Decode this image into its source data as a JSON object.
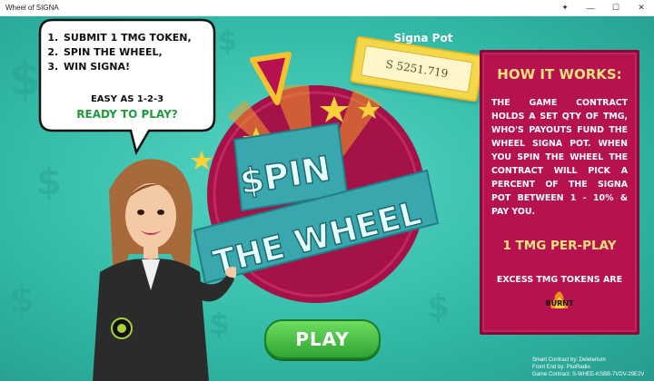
{
  "window": {
    "title": "Wheel of SIGNA",
    "controls": {
      "minimize": "—",
      "maximize": "☐",
      "close": "✕"
    }
  },
  "bubble": {
    "steps": [
      "SUBMIT 1 TMG TOKEN,",
      "SPIN THE WHEEL,",
      "WIN SIGNA!"
    ],
    "easy": "EASY AS 1-2-3",
    "ready": "READY TO PLAY?"
  },
  "wheel": {
    "line1": "$PIN",
    "line2": "THE WHEEL"
  },
  "pot": {
    "label": "Signa Pot",
    "value": "S 5251.719"
  },
  "how_it_works": {
    "title": "HOW IT WORKS:",
    "body": "THE GAME CONTRACT HOLDS A SET QTY OF TMG, WHO'S PAYOUTS FUND THE WHEEL SIGNA POT. WHEN YOU SPIN THE WHEEL THE CONTRACT WILL PICK A PERCENT OF THE SIGNA POT BETWEEN 1 - 10% & PAY YOU.",
    "per_play": "1 TMG PER-PLAY",
    "excess": "EXCESS TMG TOKENS ARE",
    "burnt": "BURNT"
  },
  "play_button": "PLAY",
  "credits": {
    "contract": "Smart Contract by: Deleterium",
    "frontend": "Front End by: PlutRadio",
    "game_contract": "Game Contract: S-WHEE-KSBB-7VDV-29E2V"
  },
  "colors": {
    "background": "#33bba8",
    "panel": "#b5124f",
    "accent_yellow": "#f6e27b",
    "play_green": "#2fa534",
    "ready_green": "#1f9b3c"
  }
}
